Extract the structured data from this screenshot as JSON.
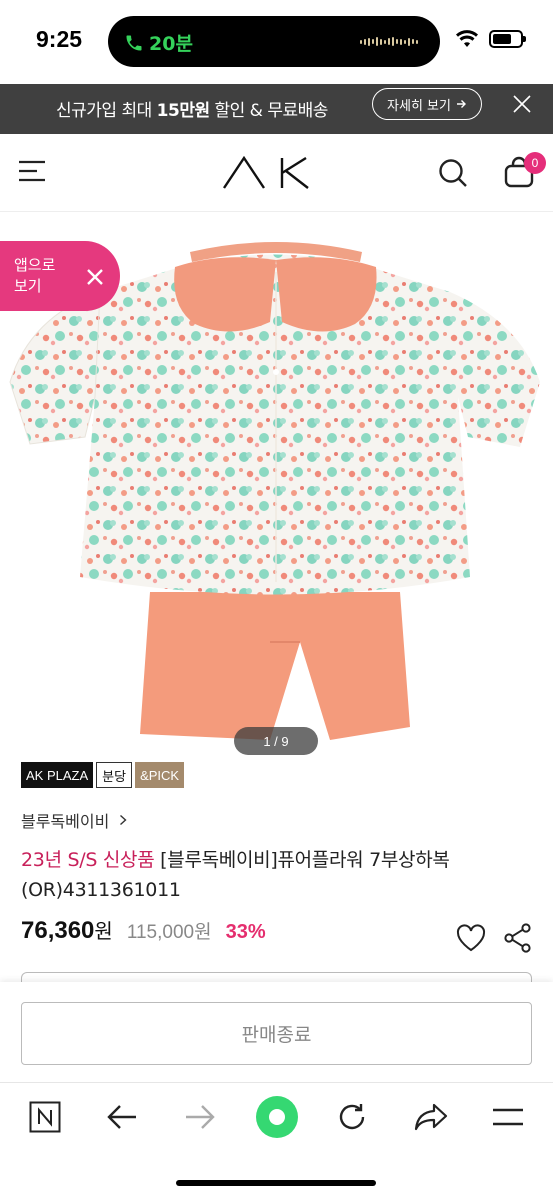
{
  "status": {
    "time": "9:25",
    "call_label": "20분"
  },
  "promo": {
    "text_before": "신규가입 최대 ",
    "text_bold": "15만원",
    "text_after": " 할인 & 무료배송",
    "more_label": "자세히 보기"
  },
  "header": {
    "logo": "AK",
    "cart_count": "0"
  },
  "app_pill": {
    "line1": "앱으로",
    "line2": "보기"
  },
  "gallery": {
    "pager": "1 / 9"
  },
  "tags": [
    "AK PLAZA",
    "분당",
    "&PICK"
  ],
  "product": {
    "brand": "블루독베이비",
    "title_prefix": "23년 S/S 신상품",
    "title": " [블루독베이비]퓨어플라워 7부상하복(OR)4311361011",
    "price": "76,360",
    "price_unit": "원",
    "original_price": "115,000원",
    "discount": "33%"
  },
  "soldout_label": "판매종료",
  "colors": {
    "accent": "#e5397e",
    "discount": "#e52e6e",
    "promo_bg": "#404040",
    "call_green": "#35d25b"
  }
}
